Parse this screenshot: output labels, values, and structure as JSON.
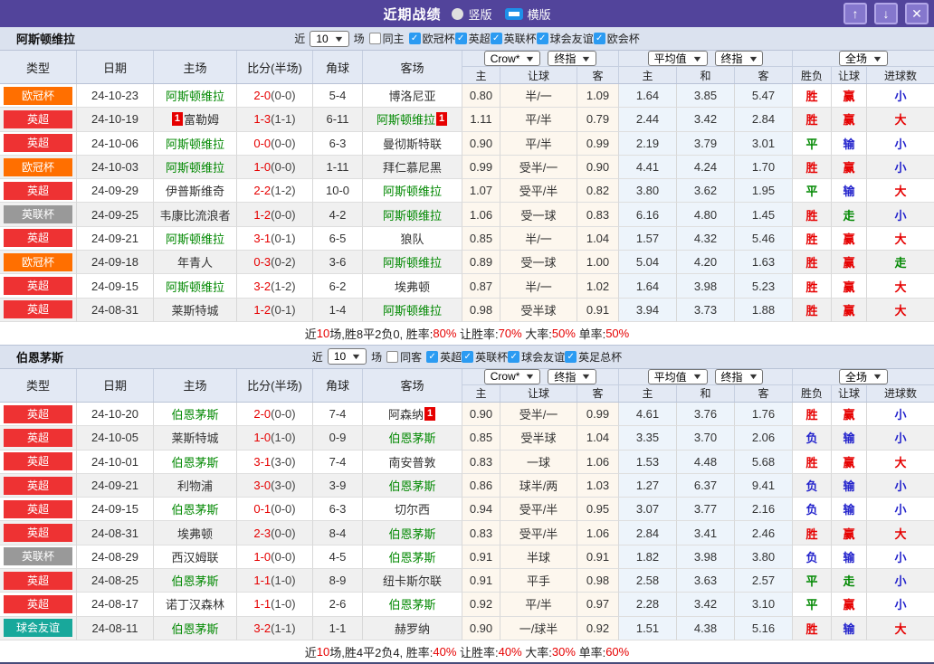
{
  "titlebar": {
    "title": "近期战绩",
    "radios": [
      {
        "label": "竖版",
        "selected": false
      },
      {
        "label": "横版",
        "selected": true
      }
    ],
    "up_icon": "↑",
    "down_icon": "↓",
    "close_icon": "✕"
  },
  "filter_labels": {
    "near": "近",
    "matches": "场"
  },
  "table_header": {
    "base_columns": [
      "类型",
      "日期",
      "主场",
      "比分(半场)",
      "角球",
      "客场"
    ],
    "odds_select": "Crow*",
    "odds_final_select": "终指",
    "avg_select": "平均值",
    "avg_final_select": "终指",
    "scope_select": "全场",
    "odds_columns": [
      "主",
      "让球",
      "客"
    ],
    "avg_columns": [
      "主",
      "和",
      "客"
    ],
    "result_columns": [
      "胜负",
      "让球",
      "进球数"
    ]
  },
  "colors": {
    "accent": "#52449b",
    "highlight_team": "#008800",
    "win_red": "#e60000",
    "loss_blue": "#2323cc",
    "draw_green": "#008800",
    "epl_badge": "#ee3233",
    "ucl_badge": "#ff6f00",
    "efl_cup_badge": "#999999",
    "friendly_badge": "#18a89b"
  },
  "sections": [
    {
      "team": "阿斯顿维拉",
      "filter": {
        "count": "10",
        "same_label": "同主",
        "same_checked": false,
        "leagues": [
          {
            "label": "欧冠杯",
            "checked": true
          },
          {
            "label": "英超",
            "checked": true
          },
          {
            "label": "英联杯",
            "checked": true
          },
          {
            "label": "球会友谊",
            "checked": true
          },
          {
            "label": "欧会杯",
            "checked": true
          }
        ]
      },
      "rows": [
        {
          "league": "欧冠杯",
          "league_color": "#ff6f00",
          "date": "24-10-23",
          "home": "阿斯顿维拉",
          "home_highlight": true,
          "home_card": "",
          "home_card_pos": "",
          "score": "2-0",
          "half": "(0-0)",
          "corners": "5-4",
          "away": "博洛尼亚",
          "away_highlight": false,
          "away_card": "",
          "away_card_pos": "",
          "odds": [
            "0.80",
            "半/一",
            "1.09"
          ],
          "avg": [
            "1.64",
            "3.85",
            "5.47"
          ],
          "results": [
            "胜",
            "赢",
            "小"
          ]
        },
        {
          "league": "英超",
          "league_color": "#ee3233",
          "date": "24-10-19",
          "home": "富勒姆",
          "home_highlight": false,
          "home_card": "1",
          "home_card_pos": "before",
          "score": "1-3",
          "half": "(1-1)",
          "corners": "6-11",
          "away": "阿斯顿维拉",
          "away_highlight": true,
          "away_card": "1",
          "away_card_pos": "after",
          "odds": [
            "1.11",
            "平/半",
            "0.79"
          ],
          "avg": [
            "2.44",
            "3.42",
            "2.84"
          ],
          "results": [
            "胜",
            "赢",
            "大"
          ]
        },
        {
          "league": "英超",
          "league_color": "#ee3233",
          "date": "24-10-06",
          "home": "阿斯顿维拉",
          "home_highlight": true,
          "home_card": "",
          "home_card_pos": "",
          "score": "0-0",
          "half": "(0-0)",
          "corners": "6-3",
          "away": "曼彻斯特联",
          "away_highlight": false,
          "away_card": "",
          "away_card_pos": "",
          "odds": [
            "0.90",
            "平/半",
            "0.99"
          ],
          "avg": [
            "2.19",
            "3.79",
            "3.01"
          ],
          "results": [
            "平",
            "输",
            "小"
          ]
        },
        {
          "league": "欧冠杯",
          "league_color": "#ff6f00",
          "date": "24-10-03",
          "home": "阿斯顿维拉",
          "home_highlight": true,
          "home_card": "",
          "home_card_pos": "",
          "score": "1-0",
          "half": "(0-0)",
          "corners": "1-11",
          "away": "拜仁慕尼黑",
          "away_highlight": false,
          "away_card": "",
          "away_card_pos": "",
          "odds": [
            "0.99",
            "受半/一",
            "0.90"
          ],
          "avg": [
            "4.41",
            "4.24",
            "1.70"
          ],
          "results": [
            "胜",
            "赢",
            "小"
          ]
        },
        {
          "league": "英超",
          "league_color": "#ee3233",
          "date": "24-09-29",
          "home": "伊普斯维奇",
          "home_highlight": false,
          "home_card": "",
          "home_card_pos": "",
          "score": "2-2",
          "half": "(1-2)",
          "corners": "10-0",
          "away": "阿斯顿维拉",
          "away_highlight": true,
          "away_card": "",
          "away_card_pos": "",
          "odds": [
            "1.07",
            "受平/半",
            "0.82"
          ],
          "avg": [
            "3.80",
            "3.62",
            "1.95"
          ],
          "results": [
            "平",
            "输",
            "大"
          ]
        },
        {
          "league": "英联杯",
          "league_color": "#999999",
          "date": "24-09-25",
          "home": "韦康比流浪者",
          "home_highlight": false,
          "home_card": "",
          "home_card_pos": "",
          "score": "1-2",
          "half": "(0-0)",
          "corners": "4-2",
          "away": "阿斯顿维拉",
          "away_highlight": true,
          "away_card": "",
          "away_card_pos": "",
          "odds": [
            "1.06",
            "受一球",
            "0.83"
          ],
          "avg": [
            "6.16",
            "4.80",
            "1.45"
          ],
          "results": [
            "胜",
            "走",
            "小"
          ]
        },
        {
          "league": "英超",
          "league_color": "#ee3233",
          "date": "24-09-21",
          "home": "阿斯顿维拉",
          "home_highlight": true,
          "home_card": "",
          "home_card_pos": "",
          "score": "3-1",
          "half": "(0-1)",
          "corners": "6-5",
          "away": "狼队",
          "away_highlight": false,
          "away_card": "",
          "away_card_pos": "",
          "odds": [
            "0.85",
            "半/一",
            "1.04"
          ],
          "avg": [
            "1.57",
            "4.32",
            "5.46"
          ],
          "results": [
            "胜",
            "赢",
            "大"
          ]
        },
        {
          "league": "欧冠杯",
          "league_color": "#ff6f00",
          "date": "24-09-18",
          "home": "年青人",
          "home_highlight": false,
          "home_card": "",
          "home_card_pos": "",
          "score": "0-3",
          "half": "(0-2)",
          "corners": "3-6",
          "away": "阿斯顿维拉",
          "away_highlight": true,
          "away_card": "",
          "away_card_pos": "",
          "odds": [
            "0.89",
            "受一球",
            "1.00"
          ],
          "avg": [
            "5.04",
            "4.20",
            "1.63"
          ],
          "results": [
            "胜",
            "赢",
            "走"
          ]
        },
        {
          "league": "英超",
          "league_color": "#ee3233",
          "date": "24-09-15",
          "home": "阿斯顿维拉",
          "home_highlight": true,
          "home_card": "",
          "home_card_pos": "",
          "score": "3-2",
          "half": "(1-2)",
          "corners": "6-2",
          "away": "埃弗顿",
          "away_highlight": false,
          "away_card": "",
          "away_card_pos": "",
          "odds": [
            "0.87",
            "半/一",
            "1.02"
          ],
          "avg": [
            "1.64",
            "3.98",
            "5.23"
          ],
          "results": [
            "胜",
            "赢",
            "大"
          ]
        },
        {
          "league": "英超",
          "league_color": "#ee3233",
          "date": "24-08-31",
          "home": "莱斯特城",
          "home_highlight": false,
          "home_card": "",
          "home_card_pos": "",
          "score": "1-2",
          "half": "(0-1)",
          "corners": "1-4",
          "away": "阿斯顿维拉",
          "away_highlight": true,
          "away_card": "",
          "away_card_pos": "",
          "odds": [
            "0.98",
            "受半球",
            "0.91"
          ],
          "avg": [
            "3.94",
            "3.73",
            "1.88"
          ],
          "results": [
            "胜",
            "赢",
            "大"
          ]
        }
      ],
      "summary": [
        [
          "近",
          "k"
        ],
        [
          "10",
          "r"
        ],
        [
          "场,胜8平2负0, 胜率:",
          "k"
        ],
        [
          "80%",
          "r"
        ],
        [
          " 让胜率:",
          "k"
        ],
        [
          "70%",
          "r"
        ],
        [
          " 大率:",
          "k"
        ],
        [
          "50%",
          "r"
        ],
        [
          " 单率:",
          "k"
        ],
        [
          "50%",
          "r"
        ]
      ]
    },
    {
      "team": "伯恩茅斯",
      "filter": {
        "count": "10",
        "same_label": "同客",
        "same_checked": false,
        "leagues": [
          {
            "label": "英超",
            "checked": true
          },
          {
            "label": "英联杯",
            "checked": true
          },
          {
            "label": "球会友谊",
            "checked": true
          },
          {
            "label": "英足总杯",
            "checked": true
          }
        ]
      },
      "rows": [
        {
          "league": "英超",
          "league_color": "#ee3233",
          "date": "24-10-20",
          "home": "伯恩茅斯",
          "home_highlight": true,
          "home_card": "",
          "home_card_pos": "",
          "score": "2-0",
          "half": "(0-0)",
          "corners": "7-4",
          "away": "阿森纳",
          "away_highlight": false,
          "away_card": "1",
          "away_card_pos": "after",
          "odds": [
            "0.90",
            "受半/一",
            "0.99"
          ],
          "avg": [
            "4.61",
            "3.76",
            "1.76"
          ],
          "results": [
            "胜",
            "赢",
            "小"
          ]
        },
        {
          "league": "英超",
          "league_color": "#ee3233",
          "date": "24-10-05",
          "home": "莱斯特城",
          "home_highlight": false,
          "home_card": "",
          "home_card_pos": "",
          "score": "1-0",
          "half": "(1-0)",
          "corners": "0-9",
          "away": "伯恩茅斯",
          "away_highlight": true,
          "away_card": "",
          "away_card_pos": "",
          "odds": [
            "0.85",
            "受半球",
            "1.04"
          ],
          "avg": [
            "3.35",
            "3.70",
            "2.06"
          ],
          "results": [
            "负",
            "输",
            "小"
          ]
        },
        {
          "league": "英超",
          "league_color": "#ee3233",
          "date": "24-10-01",
          "home": "伯恩茅斯",
          "home_highlight": true,
          "home_card": "",
          "home_card_pos": "",
          "score": "3-1",
          "half": "(3-0)",
          "corners": "7-4",
          "away": "南安普敦",
          "away_highlight": false,
          "away_card": "",
          "away_card_pos": "",
          "odds": [
            "0.83",
            "一球",
            "1.06"
          ],
          "avg": [
            "1.53",
            "4.48",
            "5.68"
          ],
          "results": [
            "胜",
            "赢",
            "大"
          ]
        },
        {
          "league": "英超",
          "league_color": "#ee3233",
          "date": "24-09-21",
          "home": "利物浦",
          "home_highlight": false,
          "home_card": "",
          "home_card_pos": "",
          "score": "3-0",
          "half": "(3-0)",
          "corners": "3-9",
          "away": "伯恩茅斯",
          "away_highlight": true,
          "away_card": "",
          "away_card_pos": "",
          "odds": [
            "0.86",
            "球半/两",
            "1.03"
          ],
          "avg": [
            "1.27",
            "6.37",
            "9.41"
          ],
          "results": [
            "负",
            "输",
            "小"
          ]
        },
        {
          "league": "英超",
          "league_color": "#ee3233",
          "date": "24-09-15",
          "home": "伯恩茅斯",
          "home_highlight": true,
          "home_card": "",
          "home_card_pos": "",
          "score": "0-1",
          "half": "(0-0)",
          "corners": "6-3",
          "away": "切尔西",
          "away_highlight": false,
          "away_card": "",
          "away_card_pos": "",
          "odds": [
            "0.94",
            "受平/半",
            "0.95"
          ],
          "avg": [
            "3.07",
            "3.77",
            "2.16"
          ],
          "results": [
            "负",
            "输",
            "小"
          ]
        },
        {
          "league": "英超",
          "league_color": "#ee3233",
          "date": "24-08-31",
          "home": "埃弗顿",
          "home_highlight": false,
          "home_card": "",
          "home_card_pos": "",
          "score": "2-3",
          "half": "(0-0)",
          "corners": "8-4",
          "away": "伯恩茅斯",
          "away_highlight": true,
          "away_card": "",
          "away_card_pos": "",
          "odds": [
            "0.83",
            "受平/半",
            "1.06"
          ],
          "avg": [
            "2.84",
            "3.41",
            "2.46"
          ],
          "results": [
            "胜",
            "赢",
            "大"
          ]
        },
        {
          "league": "英联杯",
          "league_color": "#999999",
          "date": "24-08-29",
          "home": "西汉姆联",
          "home_highlight": false,
          "home_card": "",
          "home_card_pos": "",
          "score": "1-0",
          "half": "(0-0)",
          "corners": "4-5",
          "away": "伯恩茅斯",
          "away_highlight": true,
          "away_card": "",
          "away_card_pos": "",
          "odds": [
            "0.91",
            "半球",
            "0.91"
          ],
          "avg": [
            "1.82",
            "3.98",
            "3.80"
          ],
          "results": [
            "负",
            "输",
            "小"
          ]
        },
        {
          "league": "英超",
          "league_color": "#ee3233",
          "date": "24-08-25",
          "home": "伯恩茅斯",
          "home_highlight": true,
          "home_card": "",
          "home_card_pos": "",
          "score": "1-1",
          "half": "(1-0)",
          "corners": "8-9",
          "away": "纽卡斯尔联",
          "away_highlight": false,
          "away_card": "",
          "away_card_pos": "",
          "odds": [
            "0.91",
            "平手",
            "0.98"
          ],
          "avg": [
            "2.58",
            "3.63",
            "2.57"
          ],
          "results": [
            "平",
            "走",
            "小"
          ]
        },
        {
          "league": "英超",
          "league_color": "#ee3233",
          "date": "24-08-17",
          "home": "诺丁汉森林",
          "home_highlight": false,
          "home_card": "",
          "home_card_pos": "",
          "score": "1-1",
          "half": "(1-0)",
          "corners": "2-6",
          "away": "伯恩茅斯",
          "away_highlight": true,
          "away_card": "",
          "away_card_pos": "",
          "odds": [
            "0.92",
            "平/半",
            "0.97"
          ],
          "avg": [
            "2.28",
            "3.42",
            "3.10"
          ],
          "results": [
            "平",
            "赢",
            "小"
          ]
        },
        {
          "league": "球会友谊",
          "league_color": "#18a89b",
          "date": "24-08-11",
          "home": "伯恩茅斯",
          "home_highlight": true,
          "home_card": "",
          "home_card_pos": "",
          "score": "3-2",
          "half": "(1-1)",
          "corners": "1-1",
          "away": "赫罗纳",
          "away_highlight": false,
          "away_card": "",
          "away_card_pos": "",
          "odds": [
            "0.90",
            "一/球半",
            "0.92"
          ],
          "avg": [
            "1.51",
            "4.38",
            "5.16"
          ],
          "results": [
            "胜",
            "输",
            "大"
          ]
        }
      ],
      "summary": [
        [
          "近",
          "k"
        ],
        [
          "10",
          "r"
        ],
        [
          "场,胜4平2负4, 胜率:",
          "k"
        ],
        [
          "40%",
          "r"
        ],
        [
          " 让胜率:",
          "k"
        ],
        [
          "40%",
          "r"
        ],
        [
          " 大率:",
          "k"
        ],
        [
          "30%",
          "r"
        ],
        [
          " 单率:",
          "k"
        ],
        [
          "60%",
          "r"
        ]
      ]
    }
  ]
}
